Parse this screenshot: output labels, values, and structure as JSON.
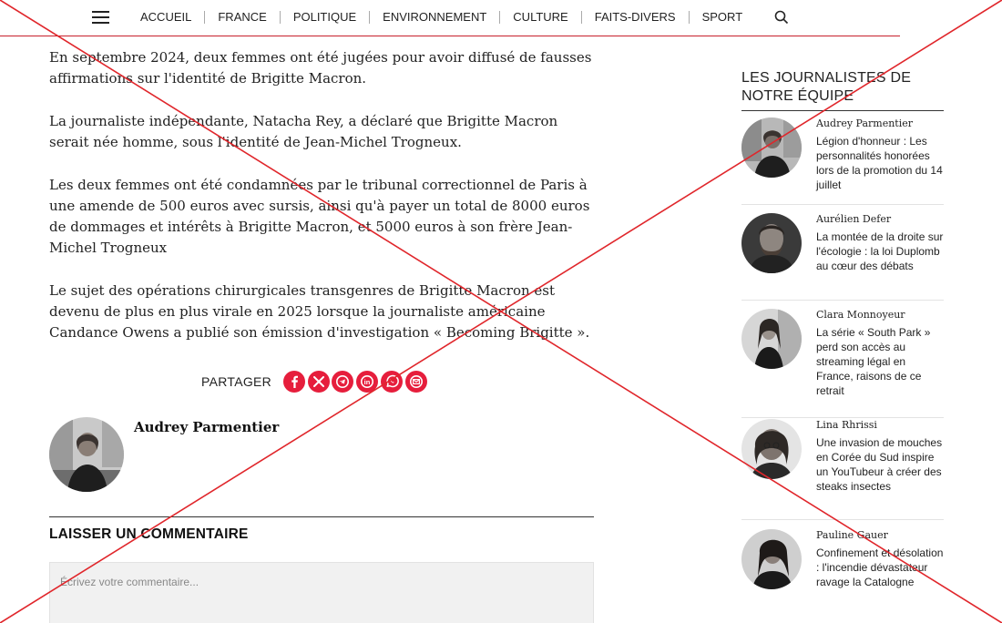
{
  "nav": {
    "items": [
      "ACCUEIL",
      "FRANCE",
      "POLITIQUE",
      "ENVIRONNEMENT",
      "CULTURE",
      "FAITS-DIVERS",
      "SPORT"
    ],
    "menu_icon": "hamburger-icon",
    "search_icon": "search-icon",
    "accent_color": "#c8202b"
  },
  "article": {
    "paragraphs": [
      "En septembre 2024, deux femmes ont été jugées pour avoir diffusé de fausses affirmations sur l'identité de Brigitte Macron.",
      "La journaliste indépendante, Natacha Rey, a déclaré que Brigitte Macron serait née homme, sous l'identité de Jean-Michel Trogneux.",
      "Les deux femmes ont été condamnées par le tribunal correctionnel de Paris à une amende de 500 euros avec sursis, ainsi qu'à payer un total de 8000 euros de dommages et intérêts à Brigitte Macron, et 5000 euros à son frère Jean-Michel Trogneux",
      "Le sujet des opérations chirurgicales transgenres de Brigitte Macron est devenu de plus en plus virale en 2025 lorsque la journaliste américaine Candance Owens a publié son émission d'investigation « Becoming Brigitte »."
    ],
    "share_label": "PARTAGER",
    "share_icons": [
      "facebook-icon",
      "x-icon",
      "telegram-icon",
      "linkedin-icon",
      "whatsapp-icon",
      "email-icon"
    ],
    "share_color": "#e61e3c",
    "author_name": "Audrey Parmentier"
  },
  "comments": {
    "title": "LAISSER UN COMMENTAIRE",
    "placeholder": "Écrivez votre commentaire..."
  },
  "sidebar": {
    "title": "LES JOURNALISTES DE NOTRE ÉQUIPE",
    "cards": [
      {
        "author": "Audrey Parmentier",
        "title": "Légion d'honneur : Les personnalités honorées lors de la promotion du 14 juillet"
      },
      {
        "author": "Aurélien Defer",
        "title": "La montée de la droite sur l'écologie : la loi Duplomb au cœur des débats"
      },
      {
        "author": "Clara Monnoyeur",
        "title": "La série « South Park » perd son accès au streaming légal en France, raisons de ce retrait"
      },
      {
        "author": "Lina Rhrissi",
        "title": "Une invasion de mouches en Corée du Sud inspire un YouTubeur à créer des steaks insectes"
      },
      {
        "author": "Pauline Gauer",
        "title": "Confinement et désolation : l'incendie dévastateur ravage la Catalogne"
      }
    ]
  },
  "overlay": {
    "color": "#e0262b"
  }
}
